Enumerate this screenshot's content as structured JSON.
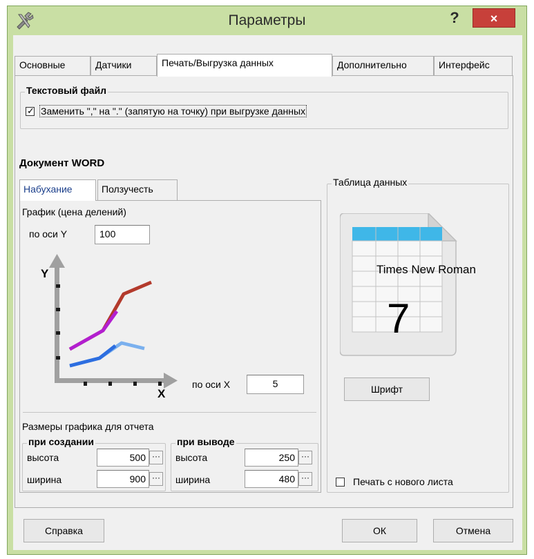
{
  "window": {
    "title": "Параметры",
    "help_label": "?",
    "close_label": "×"
  },
  "tabs": [
    {
      "label": "Основные"
    },
    {
      "label": "Датчики"
    },
    {
      "label": "Печать/Выгрузка данных"
    },
    {
      "label": "Дополнительно"
    },
    {
      "label": "Интерфейс"
    }
  ],
  "text_file": {
    "title": "Текстовый файл",
    "replace_checkbox_label": "Заменить \",\" на \".\" (запятую на точку) при выгрузке данных",
    "replace_checked": true
  },
  "word_doc": {
    "title": "Документ WORD",
    "inner_tabs": [
      {
        "label": "Набухание"
      },
      {
        "label": "Ползучесть"
      }
    ],
    "graph_title": "График (цена делений)",
    "y_axis_label": "по оси Y",
    "y_axis_value": "100",
    "x_axis_label": "по оси X",
    "x_axis_value": "5",
    "chart_y_letter": "Y",
    "chart_x_letter": "X",
    "sizes_title": "Размеры графика для отчета",
    "on_create": {
      "title": "при создании",
      "height_label": "высота",
      "height_value": "500",
      "width_label": "ширина",
      "width_value": "900"
    },
    "on_output": {
      "title": "при выводе",
      "height_label": "высота",
      "height_value": "250",
      "width_label": "ширина",
      "width_value": "480"
    },
    "ellipsis": "···"
  },
  "data_table": {
    "title": "Таблица данных",
    "font_name": "Times New Roman",
    "font_size": "7",
    "font_button": "Шрифт",
    "new_sheet_label": "Печать с нового листа",
    "new_sheet_checked": false
  },
  "footer": {
    "help_button": "Справка",
    "ok_button": "ОК",
    "cancel_button": "Отмена"
  },
  "colors": {
    "title_bar": "#c9dfa4",
    "close": "#c7403a",
    "tab_active_text": "#1b3f8b"
  }
}
